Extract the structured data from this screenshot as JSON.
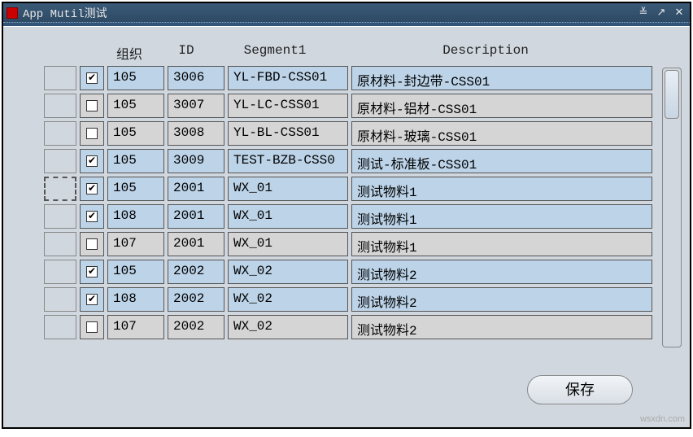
{
  "window": {
    "title": "App Mutil测试"
  },
  "headers": {
    "org": "组织",
    "id": "ID",
    "segment": "Segment1",
    "desc": "Description"
  },
  "rows": [
    {
      "checked": true,
      "marked": false,
      "org": "105",
      "id": "3006",
      "segment": "YL-FBD-CSS01",
      "desc": "原材料-封边带-CSS01",
      "tone": "odd"
    },
    {
      "checked": false,
      "marked": false,
      "org": "105",
      "id": "3007",
      "segment": "YL-LC-CSS01",
      "desc": "原材料-铝材-CSS01",
      "tone": "even"
    },
    {
      "checked": false,
      "marked": false,
      "org": "105",
      "id": "3008",
      "segment": "YL-BL-CSS01",
      "desc": "原材料-玻璃-CSS01",
      "tone": "even"
    },
    {
      "checked": true,
      "marked": false,
      "org": "105",
      "id": "3009",
      "segment": "TEST-BZB-CSS0",
      "desc": "测试-标准板-CSS01",
      "tone": "odd"
    },
    {
      "checked": true,
      "marked": true,
      "org": "105",
      "id": "2001",
      "segment": "WX_01",
      "desc": "测试物料1",
      "tone": "odd"
    },
    {
      "checked": true,
      "marked": false,
      "org": "108",
      "id": "2001",
      "segment": "WX_01",
      "desc": "测试物料1",
      "tone": "odd"
    },
    {
      "checked": false,
      "marked": false,
      "org": "107",
      "id": "2001",
      "segment": "WX_01",
      "desc": "测试物料1",
      "tone": "even"
    },
    {
      "checked": true,
      "marked": false,
      "org": "105",
      "id": "2002",
      "segment": "WX_02",
      "desc": "测试物料2",
      "tone": "odd"
    },
    {
      "checked": true,
      "marked": false,
      "org": "108",
      "id": "2002",
      "segment": "WX_02",
      "desc": "测试物料2",
      "tone": "odd"
    },
    {
      "checked": false,
      "marked": false,
      "org": "107",
      "id": "2002",
      "segment": "WX_02",
      "desc": "测试物料2",
      "tone": "even"
    }
  ],
  "buttons": {
    "save": "保存"
  },
  "watermark": "wsxdn.com"
}
